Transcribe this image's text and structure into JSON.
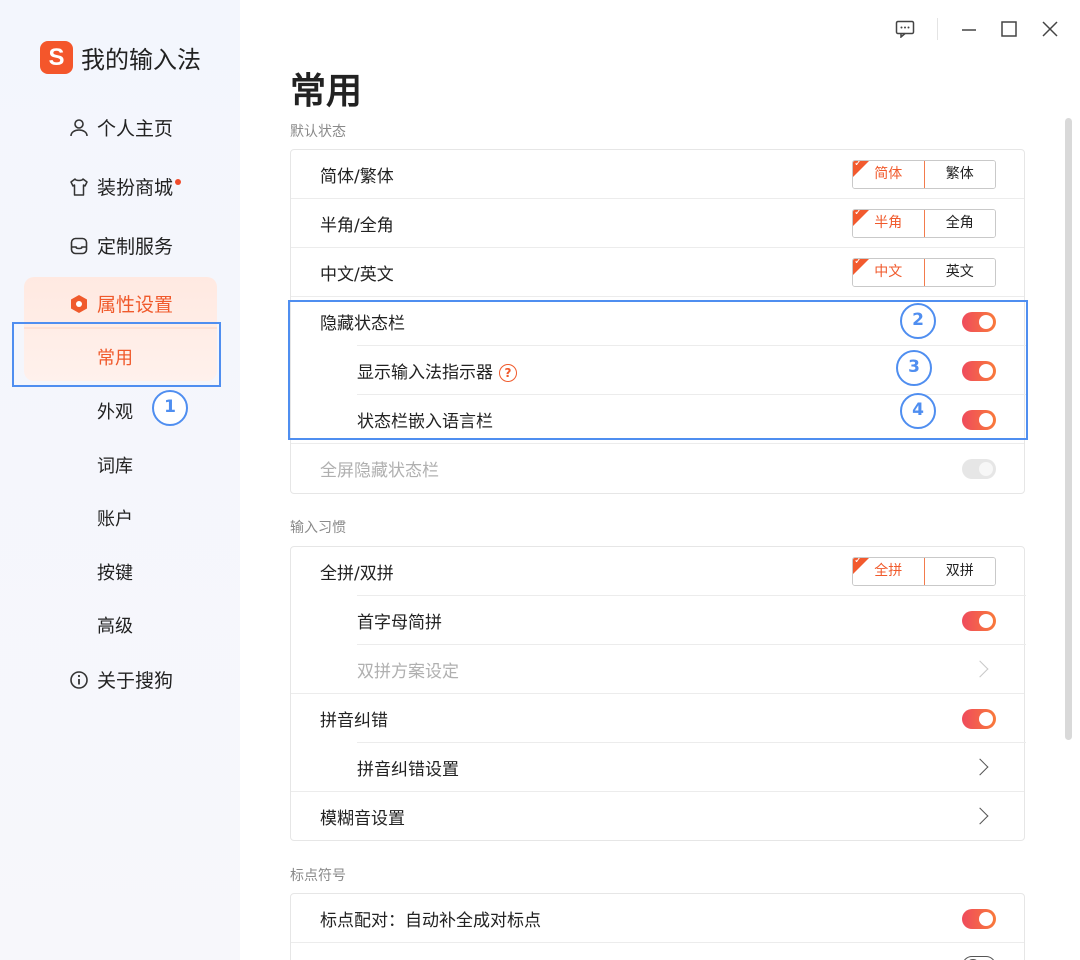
{
  "app": {
    "logo_text": "我的输入法",
    "logo_glyph": "S",
    "brand_color": "#f4562b",
    "accent_color": "#f05a2c",
    "annotation_color": "#4f8ef0"
  },
  "sidebar": {
    "items": [
      {
        "label": "个人主页",
        "icon": "user-icon"
      },
      {
        "label": "装扮商城",
        "icon": "shirt-icon",
        "badge": "red-dot"
      },
      {
        "label": "定制服务",
        "icon": "box-icon"
      },
      {
        "label": "属性设置",
        "icon": "hexagon-settings-icon"
      }
    ],
    "sub_items": [
      "常用",
      "外观",
      "词库",
      "账户",
      "按键",
      "高级"
    ],
    "about": {
      "label": "关于搜狗",
      "icon": "info-icon"
    }
  },
  "annotations": [
    "1",
    "2",
    "3",
    "4"
  ],
  "main": {
    "title": "常用",
    "sections": {
      "default_state": {
        "label": "默认状态",
        "rows": [
          {
            "label": "简体/繁体",
            "options": [
              "简体",
              "繁体"
            ],
            "selected": 0
          },
          {
            "label": "半角/全角",
            "options": [
              "半角",
              "全角"
            ],
            "selected": 0
          },
          {
            "label": "中文/英文",
            "options": [
              "中文",
              "英文"
            ],
            "selected": 0
          },
          {
            "label": "隐藏状态栏",
            "toggle": true
          },
          {
            "label": "显示输入法指示器",
            "toggle": true,
            "help_glyph": "?"
          },
          {
            "label": "状态栏嵌入语言栏",
            "toggle": true
          },
          {
            "label": "全屏隐藏状态栏",
            "toggle": true,
            "disabled": true
          }
        ]
      },
      "input_habit": {
        "label": "输入习惯",
        "rows": [
          {
            "label": "全拼/双拼",
            "options": [
              "全拼",
              "双拼"
            ],
            "selected": 0
          },
          {
            "label": "首字母简拼",
            "toggle": true
          },
          {
            "label": "双拼方案设定",
            "disabled": true
          },
          {
            "label": "拼音纠错",
            "toggle": true
          },
          {
            "label": "拼音纠错设置"
          },
          {
            "label": "模糊音设置"
          }
        ]
      },
      "punctuation": {
        "label": "标点符号",
        "rows": [
          {
            "label": "标点配对：自动补全成对标点",
            "toggle": true
          }
        ]
      }
    }
  },
  "window_controls": [
    "feedback-icon",
    "minimize-icon",
    "maximize-icon",
    "close-icon"
  ]
}
